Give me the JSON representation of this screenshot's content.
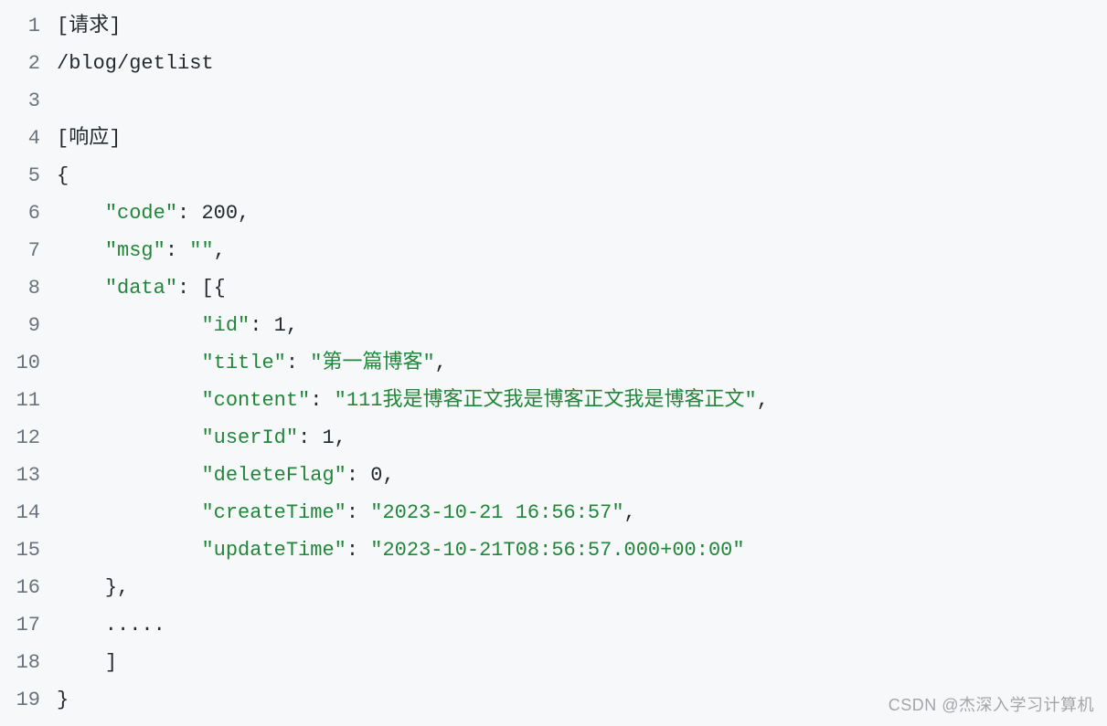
{
  "watermark": "CSDN @杰深入学习计算机",
  "lines": [
    {
      "num": "1",
      "tokens": [
        {
          "cls": "plain",
          "t": "[请求]"
        }
      ]
    },
    {
      "num": "2",
      "tokens": [
        {
          "cls": "plain",
          "t": "/blog/getlist"
        }
      ]
    },
    {
      "num": "3",
      "tokens": []
    },
    {
      "num": "4",
      "tokens": [
        {
          "cls": "plain",
          "t": "[响应]"
        }
      ]
    },
    {
      "num": "5",
      "tokens": [
        {
          "cls": "punct",
          "t": "{"
        }
      ]
    },
    {
      "num": "6",
      "tokens": [
        {
          "cls": "plain",
          "t": "    "
        },
        {
          "cls": "str",
          "t": "\"code\""
        },
        {
          "cls": "punct",
          "t": ": "
        },
        {
          "cls": "num",
          "t": "200"
        },
        {
          "cls": "punct",
          "t": ","
        }
      ]
    },
    {
      "num": "7",
      "tokens": [
        {
          "cls": "plain",
          "t": "    "
        },
        {
          "cls": "str",
          "t": "\"msg\""
        },
        {
          "cls": "punct",
          "t": ": "
        },
        {
          "cls": "str",
          "t": "\"\""
        },
        {
          "cls": "punct",
          "t": ","
        }
      ]
    },
    {
      "num": "8",
      "tokens": [
        {
          "cls": "plain",
          "t": "    "
        },
        {
          "cls": "str",
          "t": "\"data\""
        },
        {
          "cls": "punct",
          "t": ": [{"
        }
      ]
    },
    {
      "num": "9",
      "tokens": [
        {
          "cls": "plain",
          "t": "            "
        },
        {
          "cls": "str",
          "t": "\"id\""
        },
        {
          "cls": "punct",
          "t": ": "
        },
        {
          "cls": "num",
          "t": "1"
        },
        {
          "cls": "punct",
          "t": ","
        }
      ]
    },
    {
      "num": "10",
      "tokens": [
        {
          "cls": "plain",
          "t": "            "
        },
        {
          "cls": "str",
          "t": "\"title\""
        },
        {
          "cls": "punct",
          "t": ": "
        },
        {
          "cls": "str",
          "t": "\"第一篇博客\""
        },
        {
          "cls": "punct",
          "t": ","
        }
      ]
    },
    {
      "num": "11",
      "tokens": [
        {
          "cls": "plain",
          "t": "            "
        },
        {
          "cls": "str",
          "t": "\"content\""
        },
        {
          "cls": "punct",
          "t": ": "
        },
        {
          "cls": "str",
          "t": "\"111我是博客正文我是博客正文我是博客正文\""
        },
        {
          "cls": "punct",
          "t": ","
        }
      ]
    },
    {
      "num": "12",
      "tokens": [
        {
          "cls": "plain",
          "t": "            "
        },
        {
          "cls": "str",
          "t": "\"userId\""
        },
        {
          "cls": "punct",
          "t": ": "
        },
        {
          "cls": "num",
          "t": "1"
        },
        {
          "cls": "punct",
          "t": ","
        }
      ]
    },
    {
      "num": "13",
      "tokens": [
        {
          "cls": "plain",
          "t": "            "
        },
        {
          "cls": "str",
          "t": "\"deleteFlag\""
        },
        {
          "cls": "punct",
          "t": ": "
        },
        {
          "cls": "num",
          "t": "0"
        },
        {
          "cls": "punct",
          "t": ","
        }
      ]
    },
    {
      "num": "14",
      "tokens": [
        {
          "cls": "plain",
          "t": "            "
        },
        {
          "cls": "str",
          "t": "\"createTime\""
        },
        {
          "cls": "punct",
          "t": ": "
        },
        {
          "cls": "str",
          "t": "\"2023-10-21 16:56:57\""
        },
        {
          "cls": "punct",
          "t": ","
        }
      ]
    },
    {
      "num": "15",
      "tokens": [
        {
          "cls": "plain",
          "t": "            "
        },
        {
          "cls": "str",
          "t": "\"updateTime\""
        },
        {
          "cls": "punct",
          "t": ": "
        },
        {
          "cls": "str",
          "t": "\"2023-10-21T08:56:57.000+00:00\""
        }
      ]
    },
    {
      "num": "16",
      "tokens": [
        {
          "cls": "plain",
          "t": "    "
        },
        {
          "cls": "punct",
          "t": "},"
        }
      ]
    },
    {
      "num": "17",
      "tokens": [
        {
          "cls": "plain",
          "t": "    ....."
        }
      ]
    },
    {
      "num": "18",
      "tokens": [
        {
          "cls": "plain",
          "t": "    "
        },
        {
          "cls": "punct",
          "t": "]"
        }
      ]
    },
    {
      "num": "19",
      "tokens": [
        {
          "cls": "punct",
          "t": "}"
        }
      ]
    }
  ]
}
